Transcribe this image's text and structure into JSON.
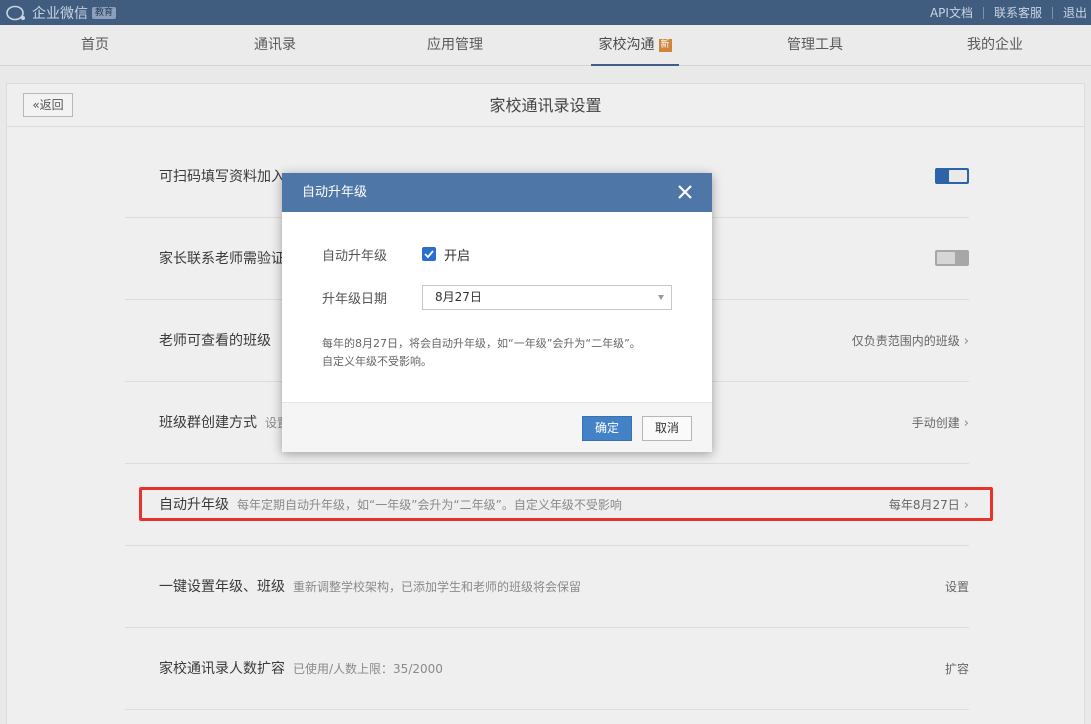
{
  "topbar": {
    "logo_text": "企业微信",
    "logo_badge": "教育",
    "links": [
      "API文档",
      "联系客服",
      "退出"
    ]
  },
  "nav": {
    "items": [
      "首页",
      "通讯录",
      "应用管理",
      "家校沟通",
      "管理工具",
      "我的企业"
    ],
    "active": "家校沟通",
    "new_badge": "新"
  },
  "page": {
    "back_label": "返回",
    "title": "家校通讯录设置"
  },
  "rows": [
    {
      "title": "可扫码填写资料加入",
      "desc": "",
      "right": "",
      "toggle": "on"
    },
    {
      "title": "家长联系老师需验证",
      "desc": "",
      "right": "",
      "toggle": "off"
    },
    {
      "title": "老师可查看的班级",
      "desc": "",
      "right": "仅负责范围内的班级"
    },
    {
      "title": "班级群创建方式",
      "desc": "设置",
      "right": "手动创建"
    },
    {
      "title": "自动升年级",
      "desc": "每年定期自动升年级，如“一年级”会升为“二年级”。自定义年级不受影响",
      "right": "每年8月27日"
    },
    {
      "title": "一键设置年级、班级",
      "desc": "重新调整学校架构，已添加学生和老师的班级将会保留",
      "right": "设置"
    },
    {
      "title": "家校通讯录人数扩容",
      "desc": "已使用/人数上限：35/2000",
      "right": "扩容"
    }
  ],
  "dialog": {
    "title": "自动升年级",
    "auto_label": "自动升年级",
    "checkbox_label": "开启",
    "checked": true,
    "date_label": "升年级日期",
    "date_value": "8月27日",
    "note_line1": "每年的8月27日，将会自动升年级，如“一年级”会升为“二年级”。",
    "note_line2": "自定义年级不受影响。",
    "ok_label": "确定",
    "cancel_label": "取消"
  },
  "colors": {
    "accent": "#4e77a7",
    "primary_button": "#4482c7",
    "highlight": "#e8332d"
  }
}
